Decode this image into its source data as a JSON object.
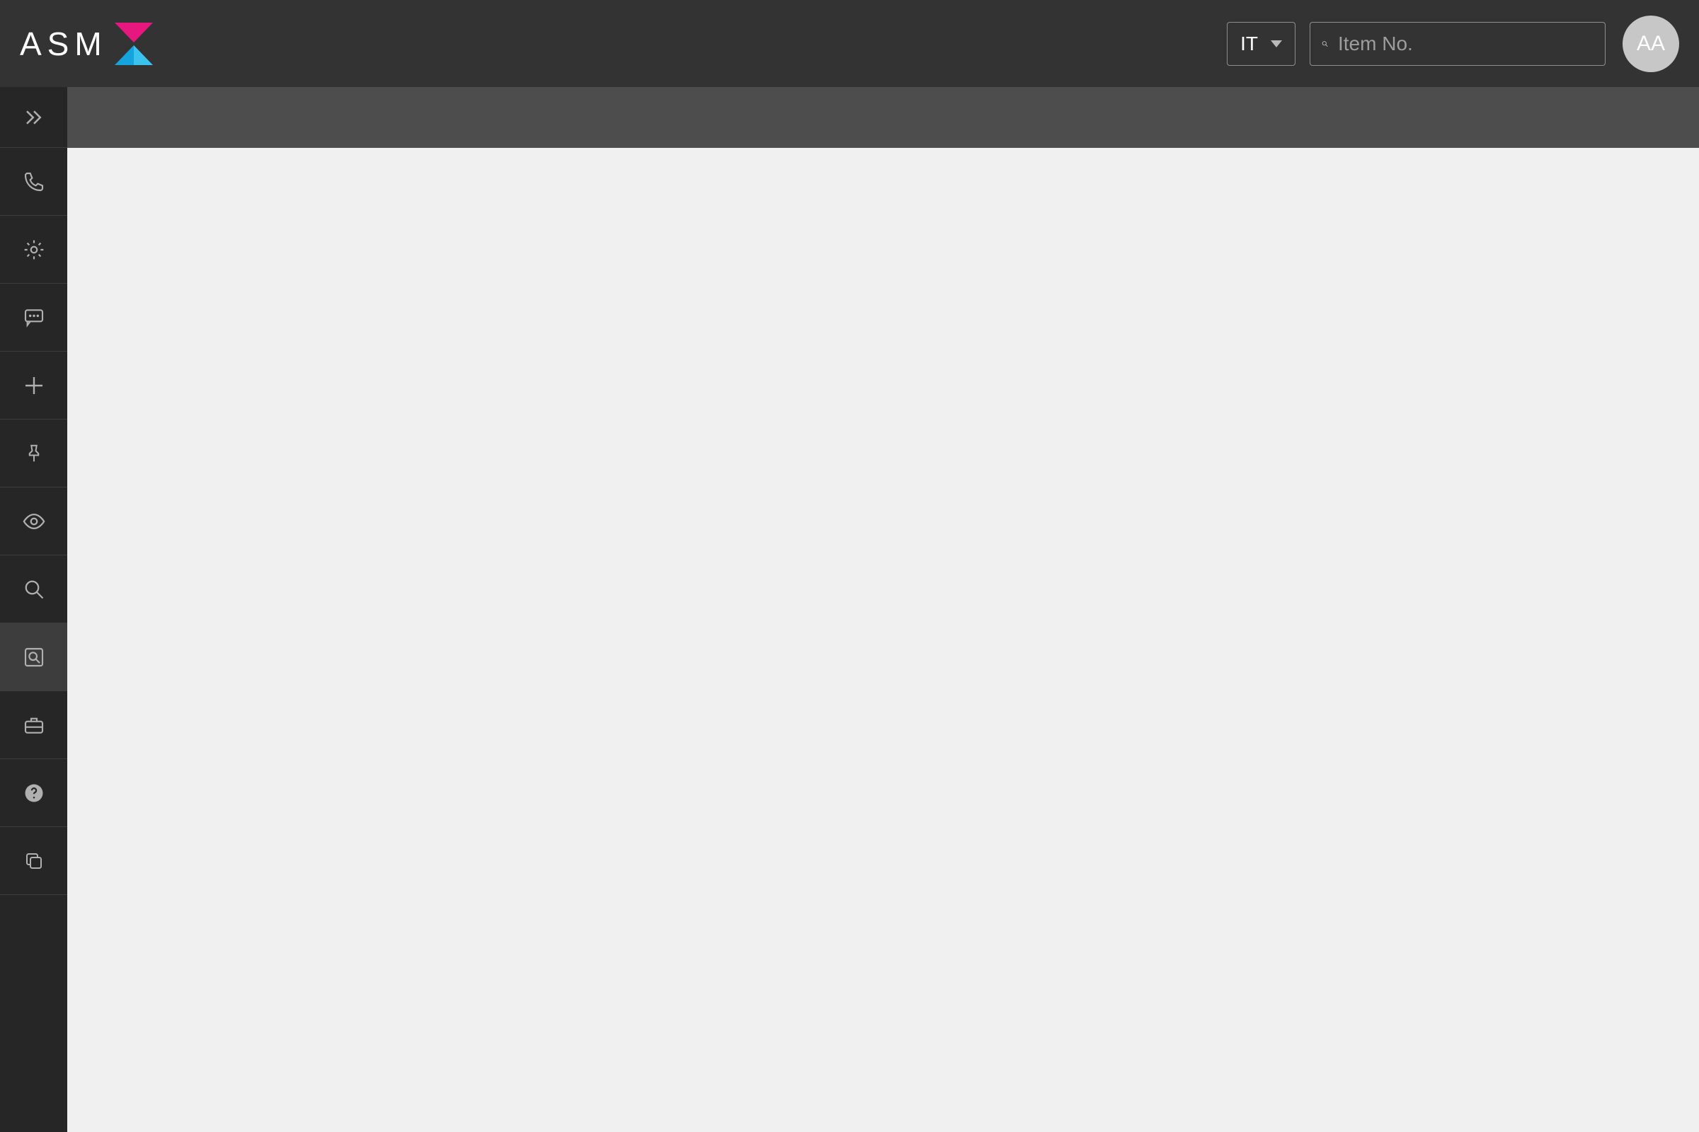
{
  "header": {
    "logo_text": "ASM",
    "language": {
      "selected": "IT"
    },
    "search": {
      "placeholder": "Item No.",
      "value": ""
    },
    "avatar_initials": "AA"
  },
  "sidebar": {
    "toggle_icon": "expand",
    "items": [
      {
        "icon": "phone"
      },
      {
        "icon": "gear"
      },
      {
        "icon": "chat"
      },
      {
        "icon": "plus"
      },
      {
        "icon": "pin"
      },
      {
        "icon": "eye"
      },
      {
        "icon": "search"
      },
      {
        "icon": "search-doc",
        "active": true
      },
      {
        "icon": "briefcase"
      },
      {
        "icon": "help"
      },
      {
        "icon": "copy"
      }
    ]
  }
}
